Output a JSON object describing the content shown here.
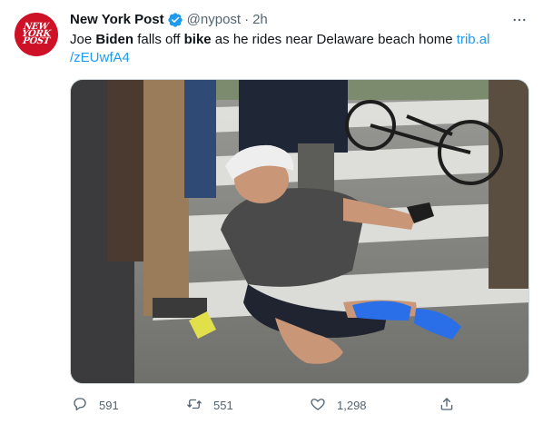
{
  "account": {
    "name": "New York Post",
    "handle": "@nypost",
    "separator": "·",
    "time": "2h",
    "avatar_lines": [
      "NEW",
      "YORK",
      "POST"
    ]
  },
  "tweet": {
    "text_parts": {
      "p1": "Joe ",
      "p2": "Biden",
      "p3": " falls off ",
      "p4": "bike",
      "p5": " as he rides near Delaware beach home ",
      "link_line1": "trib.al",
      "link_line2": "/zEUwfA4"
    }
  },
  "actions": {
    "reply_count": "591",
    "retweet_count": "551",
    "like_count": "1,298"
  },
  "colors": {
    "brand_red": "#ce1126",
    "link_blue": "#1d9bf0",
    "muted_gray": "#536471",
    "verified_blue": "#1d9bf0"
  },
  "icons": {
    "more": "more-dots-icon",
    "verified": "verified-badge-icon",
    "reply": "reply-icon",
    "retweet": "retweet-icon",
    "like": "heart-icon",
    "share": "share-icon"
  }
}
